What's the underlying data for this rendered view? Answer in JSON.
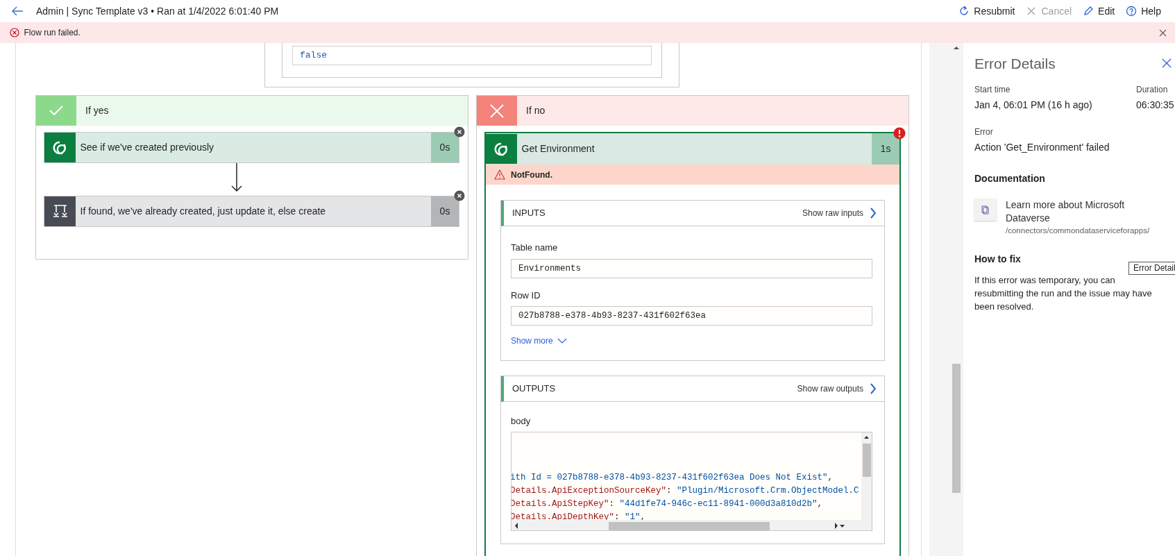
{
  "header": {
    "title": "Admin | Sync Template v3 • Ran at 1/4/2022 6:01:40 PM",
    "commands": [
      {
        "label": "Resubmit",
        "kind": "resubmit",
        "disabled": false
      },
      {
        "label": "Cancel",
        "kind": "cancel",
        "disabled": true
      },
      {
        "label": "Edit",
        "kind": "edit",
        "disabled": false
      },
      {
        "label": "Help",
        "kind": "help",
        "disabled": false
      }
    ]
  },
  "banner": {
    "message": "Flow run failed."
  },
  "condition_value": "false",
  "branches": [
    {
      "label": "If yes",
      "kind": "success",
      "actions": [
        {
          "title": "See if we've created previously",
          "duration": "0s",
          "kind": "dataverse",
          "skipped": false
        },
        {
          "title": "If found, we've already created, just update it, else create",
          "duration": "0s",
          "kind": "condition",
          "skipped": true
        }
      ]
    },
    {
      "label": "If no",
      "kind": "failure",
      "actions": [
        {
          "title": "Get Environment",
          "duration": "1s",
          "kind": "dataverse",
          "skipped": false,
          "failed": true,
          "error": "NotFound.",
          "inputs": {
            "title": "INPUTS",
            "raw_link": "Show raw inputs",
            "fields": [
              {
                "label": "Table name",
                "value": "Environments"
              },
              {
                "label": "Row ID",
                "value": "027b8788-e378-4b93-8237-431f602f63ea"
              }
            ],
            "show_more": "Show more"
          },
          "outputs": {
            "title": "OUTPUTS",
            "raw_link": "Show raw outputs",
            "body_label": "body",
            "code_lines": [
              [
                {
                  "kind": "string",
                  "text": "ith Id = 027b8788-e378-4b93-8237-431f602f63ea Does Not Exist\""
                },
                {
                  "kind": "punct",
                  "text": ","
                }
              ],
              [
                {
                  "kind": "key",
                  "text": "Details.ApiExceptionSourceKey\""
                },
                {
                  "kind": "punct",
                  "text": ": "
                },
                {
                  "kind": "string",
                  "text": "\"Plugin/Microsoft.Crm.ObjectModel.C"
                }
              ],
              [
                {
                  "kind": "key",
                  "text": "Details.ApiStepKey\""
                },
                {
                  "kind": "punct",
                  "text": ": "
                },
                {
                  "kind": "string",
                  "text": "\"44d1fe74-946c-ec11-8941-000d3a810d2b\""
                },
                {
                  "kind": "punct",
                  "text": ","
                }
              ],
              [
                {
                  "kind": "key",
                  "text": "Details.ApiDepthKey\""
                },
                {
                  "kind": "punct",
                  "text": ": "
                },
                {
                  "kind": "string",
                  "text": "\"1\""
                },
                {
                  "kind": "punct",
                  "text": ","
                }
              ]
            ]
          }
        }
      ]
    }
  ],
  "error_panel": {
    "title": "Error Details",
    "start_label": "Start time",
    "start_value": "Jan 4, 06:01 PM (16 h ago)",
    "duration_label": "Duration",
    "duration_value": "06:30:35",
    "error_label": "Error",
    "error_value": "Action 'Get_Environment' failed",
    "doc_heading": "Documentation",
    "doc_link": "Learn more about Microsoft Dataverse",
    "doc_path": "/connectors/commondataserviceforapps/",
    "fix_heading": "How to fix",
    "fix_lines": [
      "If this error was temporary, you can",
      "resubmitting the run and the issue may have",
      "been resolved."
    ],
    "tooltip": "Error Detail"
  }
}
